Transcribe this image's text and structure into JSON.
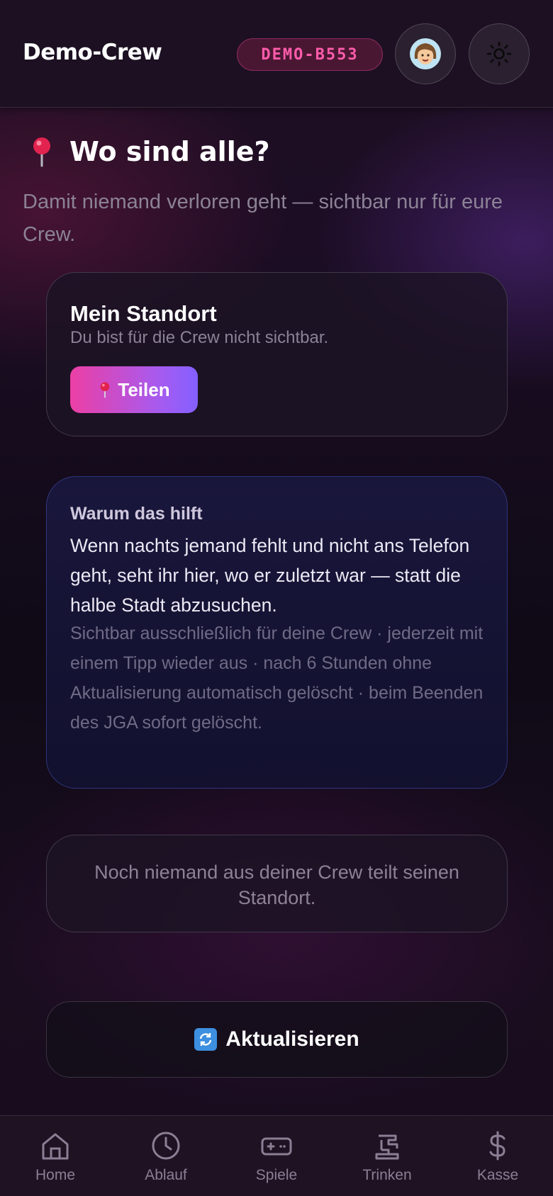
{
  "header": {
    "title": "Demo-Crew",
    "code_badge": "DEMO-B553",
    "avatar_icon": "avatar-icon",
    "theme_icon": "sun-icon"
  },
  "section": {
    "title": "Wo sind alle?",
    "subtitle": "Damit niemand verloren geht — sichtbar nur für eure Crew.",
    "icon": "pin-icon"
  },
  "location_card": {
    "title": "Mein Standort",
    "status": "Du bist für die Crew nicht sichtbar.",
    "share_label": "Teilen"
  },
  "info_card": {
    "heading": "Warum das hilft",
    "body": "Wenn nachts jemand fehlt und nicht ans Telefon geht, seht ihr hier, wo er zuletzt war — statt die halbe Stadt abzusuchen.",
    "note": "Sichtbar ausschließlich für deine Crew · jederzeit mit einem Tipp wieder aus · nach 6 Stunden ohne Aktualisierung automatisch gelöscht · beim Beenden des JGA sofort gelöscht."
  },
  "empty_state": {
    "text": "Noch niemand aus deiner Crew teilt seinen Standort."
  },
  "refresh": {
    "label": "Aktualisieren",
    "icon": "refresh-icon"
  },
  "nav": {
    "items": [
      {
        "label": "Home",
        "icon": "home-icon"
      },
      {
        "label": "Ablauf",
        "icon": "clock-icon"
      },
      {
        "label": "Spiele",
        "icon": "gamepad-icon"
      },
      {
        "label": "Trinken",
        "icon": "beer-tap-icon"
      },
      {
        "label": "Kasse",
        "icon": "dollar-icon"
      }
    ]
  },
  "colors": {
    "accent_pink": "#ec3fa4",
    "accent_purple": "#8460ff",
    "badge_text": "#ff5cab"
  }
}
